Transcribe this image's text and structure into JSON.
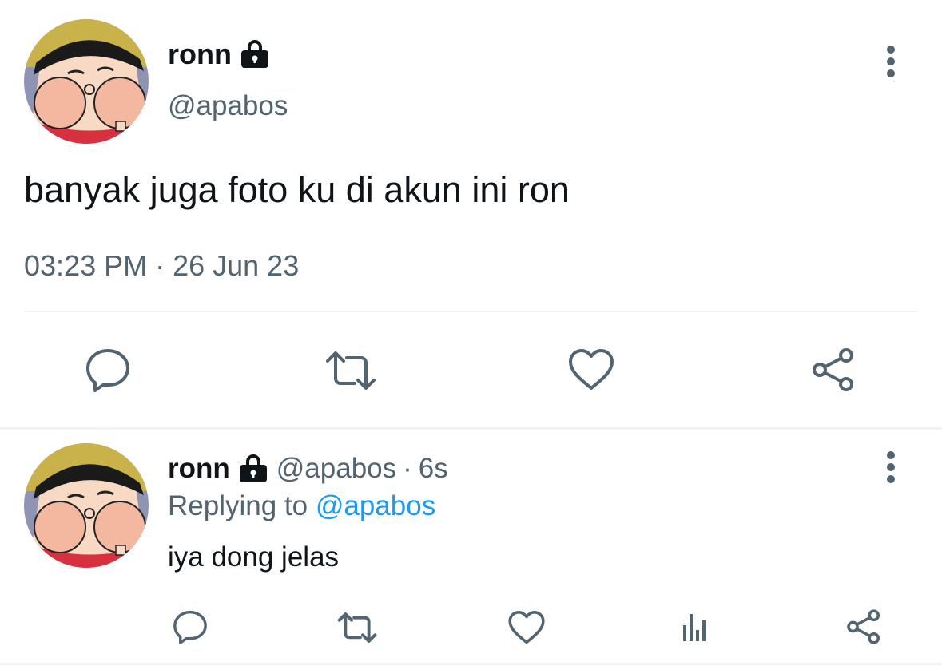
{
  "main_tweet": {
    "author_name": "ronn",
    "author_handle": "@apabos",
    "text": "banyak juga foto ku di akun ini ron",
    "time": "03:23 PM",
    "separator": "·",
    "date": "26 Jun 23",
    "protected_icon": "lock-icon",
    "more_icon": "more-vertical-icon",
    "actions": [
      "reply-icon",
      "retweet-icon",
      "like-icon",
      "share-icon"
    ]
  },
  "reply_tweet": {
    "author_name": "ronn",
    "author_handle": "@apabos",
    "separator": "·",
    "age": "6s",
    "replying_label": "Replying to",
    "replying_handle": "@apabos",
    "text": "iya dong jelas",
    "protected_icon": "lock-icon",
    "more_icon": "more-vertical-icon",
    "actions": [
      "reply-icon",
      "retweet-icon",
      "like-icon",
      "analytics-icon",
      "share-icon"
    ]
  },
  "colors": {
    "text": "#0f1419",
    "muted": "#536471",
    "link": "#1d9bf0",
    "divider": "#eff3f4"
  }
}
